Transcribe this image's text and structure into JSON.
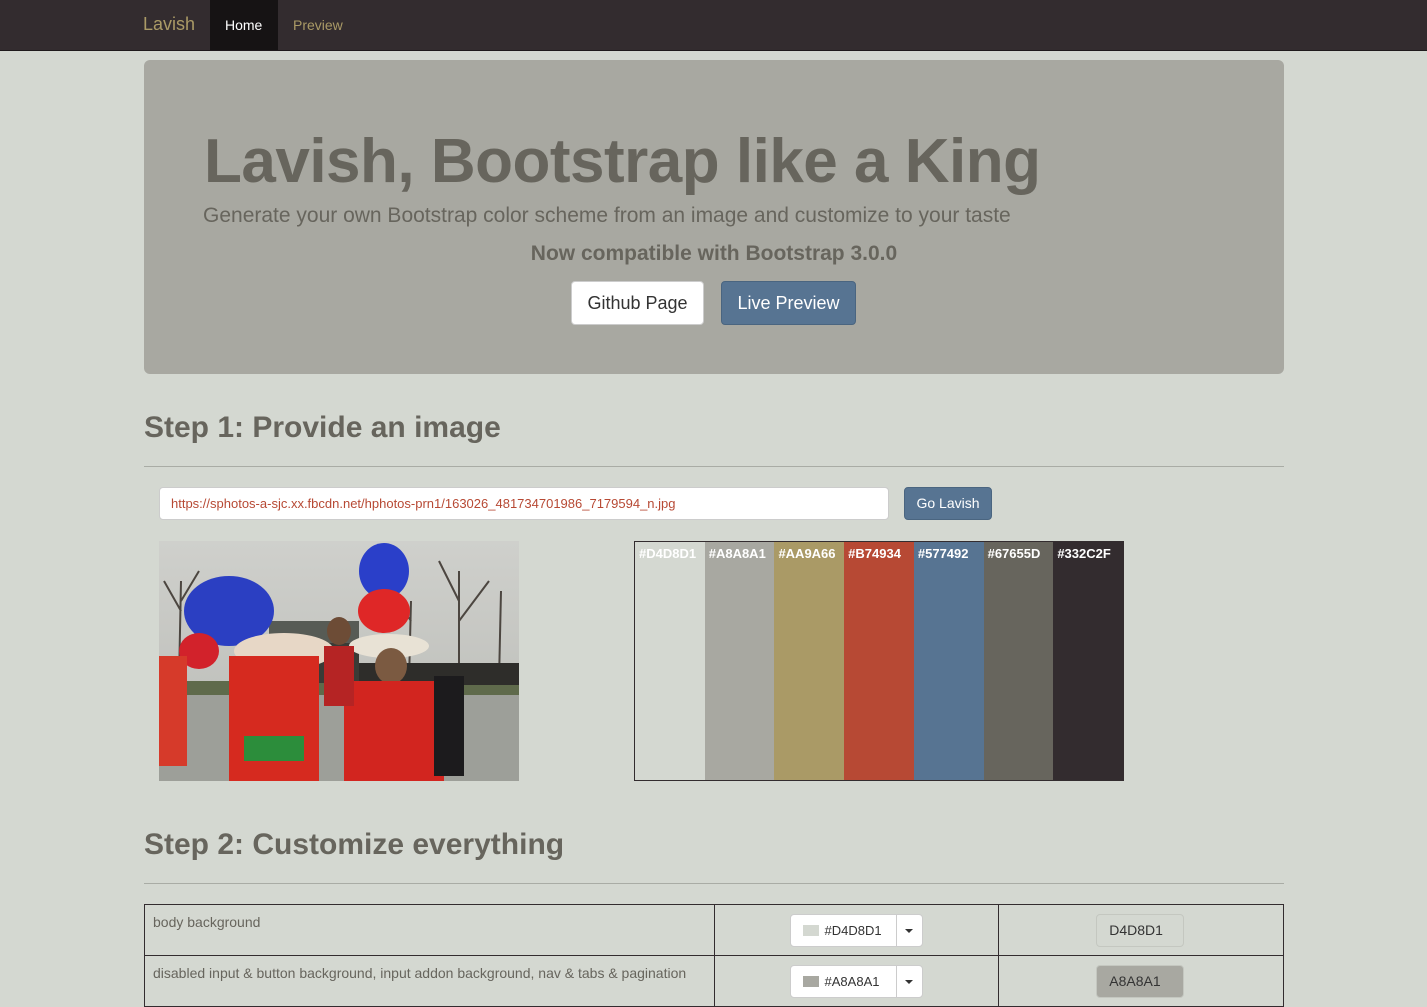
{
  "navbar": {
    "brand": "Lavish",
    "items": [
      {
        "label": "Home",
        "active": true
      },
      {
        "label": "Preview",
        "active": false
      }
    ]
  },
  "jumbotron": {
    "title": "Lavish, Bootstrap like a King",
    "subtitle": "Generate your own Bootstrap color scheme from an image and customize to your taste",
    "compat": "Now compatible with Bootstrap 3.0.0",
    "github_button": "Github Page",
    "preview_button": "Live Preview"
  },
  "step1": {
    "heading": "Step 1: Provide an image",
    "url_value": "https://sphotos-a-sjc.xx.fbcdn.net/hphotos-prn1/163026_481734701986_7179594_n.jpg",
    "go_button": "Go Lavish"
  },
  "palette": [
    {
      "label": "#D4D8D1",
      "color": "#D4D8D1"
    },
    {
      "label": "#A8A8A1",
      "color": "#A8A8A1"
    },
    {
      "label": "#AA9A66",
      "color": "#AA9A66"
    },
    {
      "label": "#B74934",
      "color": "#B74934"
    },
    {
      "label": "#577492",
      "color": "#577492"
    },
    {
      "label": "#67655D",
      "color": "#67655D"
    },
    {
      "label": "#332C2F",
      "color": "#332C2F"
    }
  ],
  "step2": {
    "heading": "Step 2: Customize everything",
    "rows": [
      {
        "label": "body background",
        "picker_value": "#D4D8D1",
        "hex": "D4D8D1",
        "color": "#D4D8D1"
      },
      {
        "label": "disabled input & button background, input addon background, nav & tabs & pagination",
        "picker_value": "#A8A8A1",
        "hex": "A8A8A1",
        "color": "#A8A8A1"
      }
    ]
  },
  "colors": {
    "navbar_bg": "#332C2F",
    "accent": "#AA9A66",
    "primary": "#577492",
    "text": "#67655D",
    "danger": "#B74934"
  }
}
